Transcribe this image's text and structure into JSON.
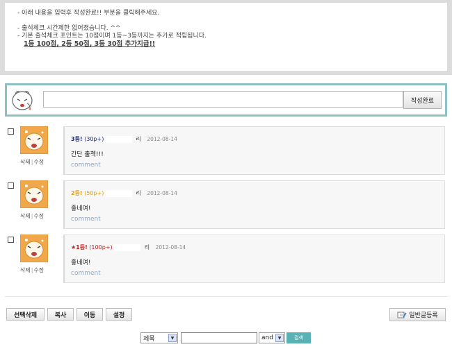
{
  "notice": {
    "line1": "- 아래 내용을 입력후 작성완료!! 부분을 클릭해주세요.",
    "line2": "- 출석체크 시간제한 없어졌습니다. ^^",
    "line3": "- 기본 출석체크 포인트는 10점이며 1등~3등까지는 추가로 적립됩니다.",
    "bonus": "1등 100점, 2등 50점, 3등 30점 추가지급!!"
  },
  "write": {
    "submit_label": "작성완료",
    "input_value": ""
  },
  "comments": [
    {
      "rank": "3등!",
      "points": "(30p+)",
      "rank_color": "#1a2a6c",
      "author_tail": "리",
      "date": "2012-08-14",
      "text": "간단 출첵!!!",
      "link": "comment",
      "delete_label": "삭제",
      "edit_label": "수정"
    },
    {
      "rank": "2등!",
      "points": "(50p+)",
      "rank_color": "#e0a21a",
      "author_tail": "리",
      "date": "2012-08-14",
      "text": "좋네여!",
      "link": "comment",
      "delete_label": "삭제",
      "edit_label": "수정"
    },
    {
      "rank": "★1등!",
      "points": "(100p+)",
      "rank_color": "#c0201e",
      "author_tail": "리",
      "date": "2012-08-14",
      "text": "좋네여!",
      "link": "comment",
      "delete_label": "삭제",
      "edit_label": "수정"
    }
  ],
  "actions": {
    "delete_selected": "선택삭제",
    "copy": "복사",
    "move": "이동",
    "settings": "설정",
    "write_new": "일반글등록"
  },
  "search": {
    "field_option": "제목",
    "operator_option": "and",
    "query": "",
    "button": "검색"
  }
}
